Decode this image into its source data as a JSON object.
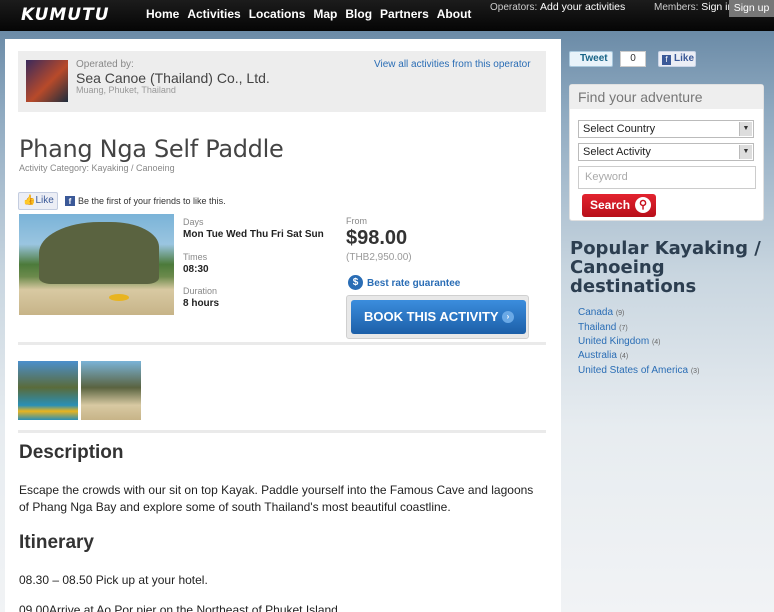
{
  "nav": {
    "logo": "KUMUTU",
    "links": [
      "Home",
      "Activities",
      "Locations",
      "Map",
      "Blog",
      "Partners",
      "About"
    ],
    "operators_label": "Operators:",
    "operators_link": "Add your activities",
    "members_label": "Members:",
    "sign_in": "Sign in",
    "sign_up": "Sign up"
  },
  "operator": {
    "operated_by": "Operated by:",
    "name": "Sea Canoe (Thailand) Co., Ltd.",
    "location": "Muang, Phuket, Thailand",
    "view_all_link": "View all activities from this operator"
  },
  "activity": {
    "title": "Phang Nga Self Paddle",
    "category": "Activity Category: Kayaking / Canoeing",
    "like_label": "Like",
    "fb_text": "Be the first of your friends to like this.",
    "days_label": "Days",
    "days_value": "Mon Tue Wed Thu Fri Sat Sun",
    "times_label": "Times",
    "times_value": "08:30",
    "duration_label": "Duration",
    "duration_value": "8 hours",
    "from_label": "From",
    "price": "$98.00",
    "price_local": "(THB2,950.00)",
    "best_rate": "Best rate guarantee",
    "book_button": "BOOK THIS ACTIVITY"
  },
  "content": {
    "description_heading": "Description",
    "description_text": "Escape the crowds with our sit on top Kayak. Paddle yourself into the Famous Cave and lagoons of Phang Nga Bay and explore some of south Thailand's most beautiful coastline.",
    "itinerary_heading": "Itinerary",
    "itinerary_line1": "08.30 – 08.50 Pick up at your hotel.",
    "itinerary_line2": "09.00Arrive at Ao Por pier on the Northeast of Phuket Island"
  },
  "sidebar": {
    "tweet_label": "Tweet",
    "tweet_count": "0",
    "fb_like_label": "Like",
    "search_title": "Find your adventure",
    "select_country": "Select Country",
    "select_activity": "Select Activity",
    "keyword_placeholder": "Keyword",
    "search_button": "Search",
    "popular_heading": "Popular Kayaking / Canoeing destinations",
    "destinations": [
      {
        "name": "Canada",
        "count": "(9)"
      },
      {
        "name": "Thailand",
        "count": "(7)"
      },
      {
        "name": "United Kingdom",
        "count": "(4)"
      },
      {
        "name": "Australia",
        "count": "(4)"
      },
      {
        "name": "United States of America",
        "count": "(3)"
      }
    ]
  },
  "colors": {
    "link_blue": "#2a6db5",
    "book_blue": "#1c5fa8",
    "search_red": "#c8121e",
    "heading_navy": "#2c3e50"
  }
}
